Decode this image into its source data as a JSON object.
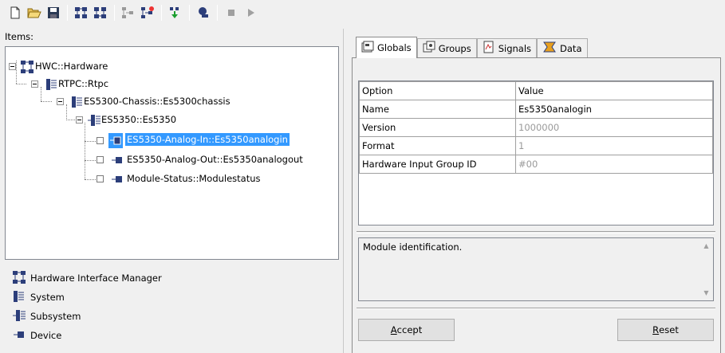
{
  "toolbar": {
    "icons": [
      "new-icon",
      "open-icon",
      "save-icon",
      "add-hardware-icon",
      "remove-hardware-icon",
      "properties-icon",
      "configure-icon",
      "download-icon",
      "connect-icon",
      "stop-icon",
      "run-icon"
    ]
  },
  "items_label": "Items:",
  "tree": [
    {
      "label": "HWC::Hardware",
      "icon": "hardware-interface-manager-icon"
    },
    {
      "label": "RTPC::Rtpc",
      "icon": "system-icon"
    },
    {
      "label": "ES5300-Chassis::Es5300chassis",
      "icon": "system-icon"
    },
    {
      "label": "ES5350::Es5350",
      "icon": "subsystem-icon"
    },
    {
      "label": "ES5350-Analog-In::Es5350analogin",
      "icon": "device-icon",
      "selected": true
    },
    {
      "label": "ES5350-Analog-Out::Es5350analogout",
      "icon": "device-icon"
    },
    {
      "label": "Module-Status::Modulestatus",
      "icon": "device-icon"
    }
  ],
  "legend": [
    {
      "label": "Hardware Interface Manager",
      "icon": "hardware-interface-manager-icon"
    },
    {
      "label": "System",
      "icon": "system-icon"
    },
    {
      "label": "Subsystem",
      "icon": "subsystem-icon"
    },
    {
      "label": "Device",
      "icon": "device-icon"
    }
  ],
  "tabs": [
    {
      "label": "Globals",
      "icon": "globals-icon",
      "active": true
    },
    {
      "label": "Groups",
      "icon": "groups-icon"
    },
    {
      "label": "Signals",
      "icon": "signals-icon"
    },
    {
      "label": "Data",
      "icon": "data-icon"
    }
  ],
  "grid": {
    "headers": [
      "Option",
      "Value"
    ],
    "rows": [
      {
        "option": "Name",
        "value": "Es5350analogin",
        "readonly": false
      },
      {
        "option": "Version",
        "value": "1000000",
        "readonly": true
      },
      {
        "option": "Format",
        "value": "1",
        "readonly": true
      },
      {
        "option": "Hardware Input Group ID",
        "value": "#00",
        "readonly": true
      }
    ]
  },
  "description": "Module identification.",
  "buttons": {
    "accept": {
      "first": "A",
      "rest": "ccept"
    },
    "reset": {
      "first": "R",
      "rest": "eset"
    }
  }
}
